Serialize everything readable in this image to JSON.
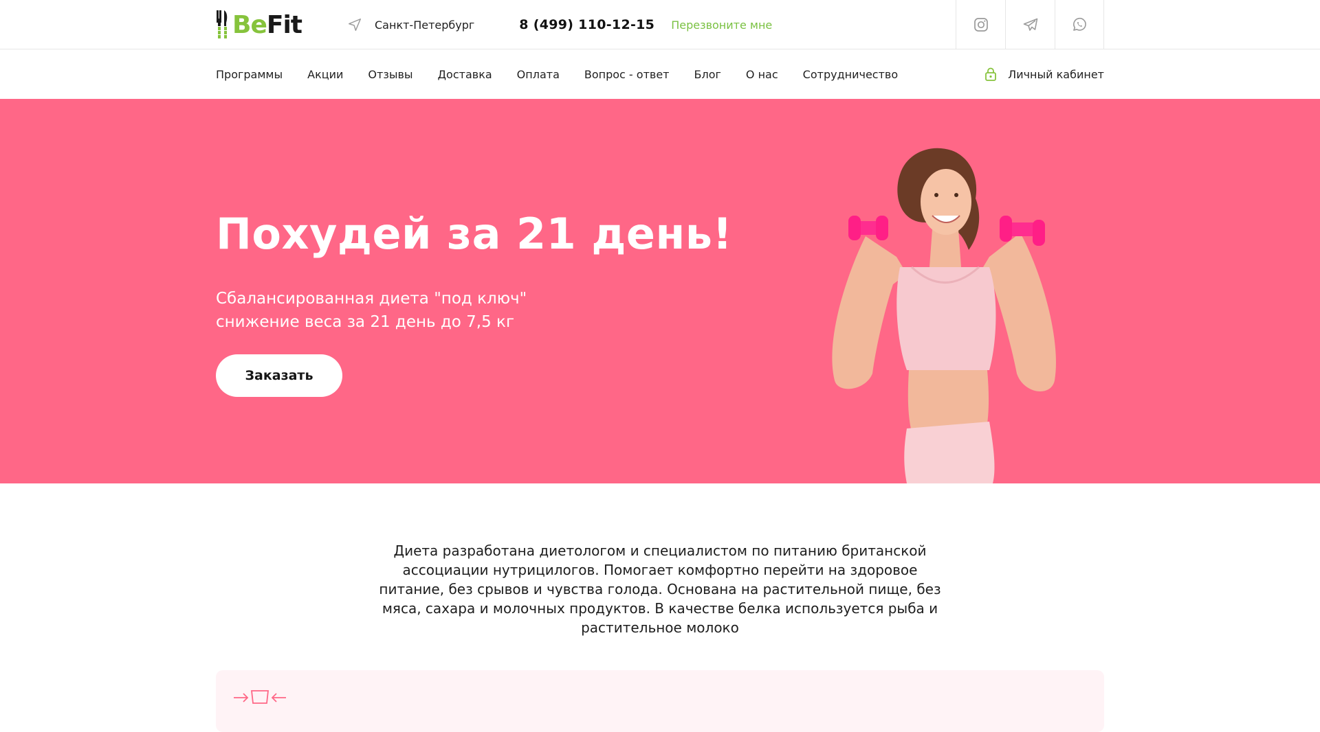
{
  "brand": {
    "logo_prefix": "Be",
    "logo_suffix": "Fit",
    "accent_green": "#86c33c",
    "hero_pink": "#ff6787"
  },
  "header": {
    "city": "Санкт-Петербург",
    "city_icon": "location-arrow-icon",
    "phone": "8 (499) 110-12-15",
    "callback_label": "Перезвоните мне",
    "socials": [
      {
        "icon": "instagram-icon"
      },
      {
        "icon": "telegram-icon"
      },
      {
        "icon": "whatsapp-icon"
      }
    ]
  },
  "nav": {
    "items": [
      {
        "label": "Программы"
      },
      {
        "label": "Акции"
      },
      {
        "label": "Отзывы"
      },
      {
        "label": "Доставка"
      },
      {
        "label": "Оплата"
      },
      {
        "label": "Вопрос - ответ"
      },
      {
        "label": "Блог"
      },
      {
        "label": "О нас"
      },
      {
        "label": "Сотрудничество"
      }
    ],
    "account_label": "Личный кабинет",
    "account_icon": "lock-icon"
  },
  "hero": {
    "title": "Похудей за 21 день!",
    "subtitle_line1": "Сбалансированная диета \"под ключ\"",
    "subtitle_line2": "снижение веса за 21 день до 7,5 кг",
    "order_button": "Заказать"
  },
  "about": {
    "text": "Диета разработана диетологом и специалистом по питанию британской ассоциации нутрицилогов. Помогает комфортно перейти на здоровое питание, без срывов и чувства голода. Основана на растительной пище, без мяса, сахара и молочных продуктов. В качестве белка используется рыба и растительное молоко"
  }
}
